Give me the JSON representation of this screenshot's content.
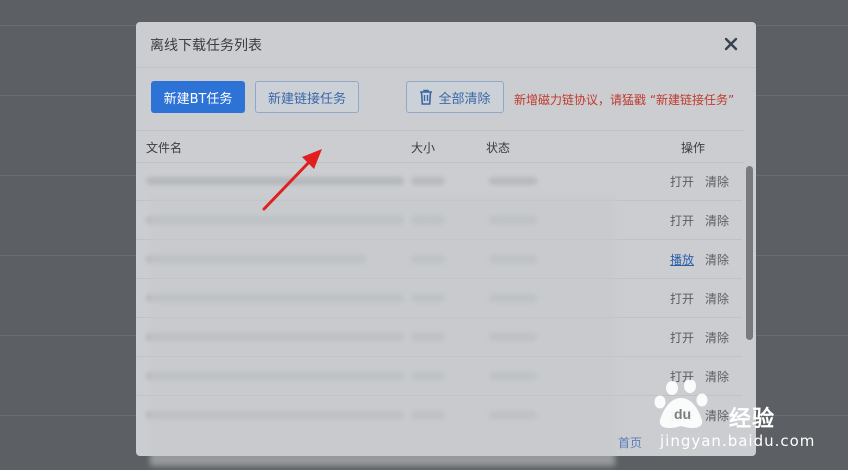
{
  "dialog": {
    "title": "离线下载任务列表",
    "close_icon": "close-icon"
  },
  "toolbar": {
    "new_bt_label": "新建BT任务",
    "new_link_label": "新建链接任务",
    "clear_all_label": "全部清除",
    "clear_all_icon": "trash-icon",
    "notice": "新增磁力链协议，请猛戳 “新建链接任务”"
  },
  "table": {
    "columns": [
      "文件名",
      "大小",
      "状态",
      "操作"
    ],
    "rows": [
      {
        "action_primary": "打开",
        "action_secondary": "清除"
      },
      {
        "action_primary": "打开",
        "action_secondary": "清除"
      },
      {
        "action_primary": "播放",
        "action_secondary": "清除"
      },
      {
        "action_primary": "打开",
        "action_secondary": "清除"
      },
      {
        "action_primary": "打开",
        "action_secondary": "清除"
      },
      {
        "action_primary": "打开",
        "action_secondary": "清除"
      },
      {
        "action_primary": "打开",
        "action_secondary": "清除"
      }
    ]
  },
  "pager": {
    "first_label": "首页"
  },
  "watermark": {
    "brand": "经验",
    "url": "jingyan.baidu.com"
  },
  "colors": {
    "primary": "#2d73d6",
    "notice": "#c0392b",
    "annotation_arrow": "#e02020"
  }
}
